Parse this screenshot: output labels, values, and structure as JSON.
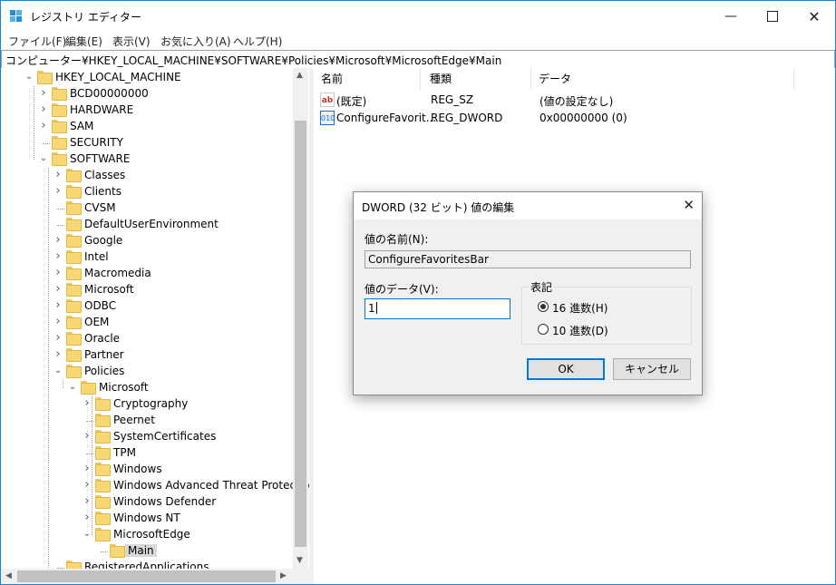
{
  "window": {
    "title": "レジストリ エディター"
  },
  "menu": [
    "ファイル(F)",
    "編集(E)",
    "表示(V)",
    "お気に入り(A)",
    "ヘルプ(H)"
  ],
  "address": "コンピューター¥HKEY_LOCAL_MACHINE¥SOFTWARE¥Policies¥Microsoft¥MicrosoftEdge¥Main",
  "tree": [
    {
      "label": "HKEY_LOCAL_MACHINE",
      "level": 0,
      "expanded": true,
      "has_children": true
    },
    {
      "label": "BCD00000000",
      "level": 1,
      "expanded": false,
      "has_children": true
    },
    {
      "label": "HARDWARE",
      "level": 1,
      "expanded": false,
      "has_children": true
    },
    {
      "label": "SAM",
      "level": 1,
      "expanded": false,
      "has_children": true
    },
    {
      "label": "SECURITY",
      "level": 1,
      "expanded": false,
      "has_children": false
    },
    {
      "label": "SOFTWARE",
      "level": 1,
      "expanded": true,
      "has_children": true
    },
    {
      "label": "Classes",
      "level": 2,
      "expanded": false,
      "has_children": true
    },
    {
      "label": "Clients",
      "level": 2,
      "expanded": false,
      "has_children": true
    },
    {
      "label": "CVSM",
      "level": 2,
      "expanded": false,
      "has_children": false
    },
    {
      "label": "DefaultUserEnvironment",
      "level": 2,
      "expanded": false,
      "has_children": false
    },
    {
      "label": "Google",
      "level": 2,
      "expanded": false,
      "has_children": true
    },
    {
      "label": "Intel",
      "level": 2,
      "expanded": false,
      "has_children": true
    },
    {
      "label": "Macromedia",
      "level": 2,
      "expanded": false,
      "has_children": true
    },
    {
      "label": "Microsoft",
      "level": 2,
      "expanded": false,
      "has_children": true
    },
    {
      "label": "ODBC",
      "level": 2,
      "expanded": false,
      "has_children": true
    },
    {
      "label": "OEM",
      "level": 2,
      "expanded": false,
      "has_children": true
    },
    {
      "label": "Oracle",
      "level": 2,
      "expanded": false,
      "has_children": true
    },
    {
      "label": "Partner",
      "level": 2,
      "expanded": false,
      "has_children": true
    },
    {
      "label": "Policies",
      "level": 2,
      "expanded": true,
      "has_children": true
    },
    {
      "label": "Microsoft",
      "level": 3,
      "expanded": true,
      "has_children": true
    },
    {
      "label": "Cryptography",
      "level": 4,
      "expanded": false,
      "has_children": true
    },
    {
      "label": "Peernet",
      "level": 4,
      "expanded": false,
      "has_children": false
    },
    {
      "label": "SystemCertificates",
      "level": 4,
      "expanded": false,
      "has_children": true
    },
    {
      "label": "TPM",
      "level": 4,
      "expanded": false,
      "has_children": false
    },
    {
      "label": "Windows",
      "level": 4,
      "expanded": false,
      "has_children": true
    },
    {
      "label": "Windows Advanced Threat Protection",
      "level": 4,
      "expanded": false,
      "has_children": true
    },
    {
      "label": "Windows Defender",
      "level": 4,
      "expanded": false,
      "has_children": true
    },
    {
      "label": "Windows NT",
      "level": 4,
      "expanded": false,
      "has_children": true
    },
    {
      "label": "MicrosoftEdge",
      "level": 4,
      "expanded": true,
      "has_children": true
    },
    {
      "label": "Main",
      "level": 5,
      "expanded": false,
      "has_children": false,
      "selected": true
    },
    {
      "label": "RegisteredApplications",
      "level": 2,
      "expanded": false,
      "has_children": false
    }
  ],
  "list": {
    "columns": [
      "名前",
      "種類",
      "データ"
    ],
    "rows": [
      {
        "icon": "string-value-icon",
        "name": "(既定)",
        "type": "REG_SZ",
        "data": "(値の設定なし)"
      },
      {
        "icon": "dword-value-icon",
        "name": "ConfigureFavorit...",
        "type": "REG_DWORD",
        "data": "0x00000000 (0)"
      }
    ]
  },
  "dialog": {
    "title": "DWORD (32 ビット) 値の編集",
    "name_label": "値の名前(N):",
    "name_value": "ConfigureFavoritesBar",
    "data_label": "値のデータ(V):",
    "data_value": "1",
    "base_label": "表記",
    "base_hex": "16 進数(H)",
    "base_dec": "10 進数(D)",
    "selected_base": "hex",
    "ok": "OK",
    "cancel": "キャンセル"
  },
  "colors": {
    "accent": "#0078d7",
    "folder": "#f8d775",
    "selection": "#d9d9d9"
  }
}
